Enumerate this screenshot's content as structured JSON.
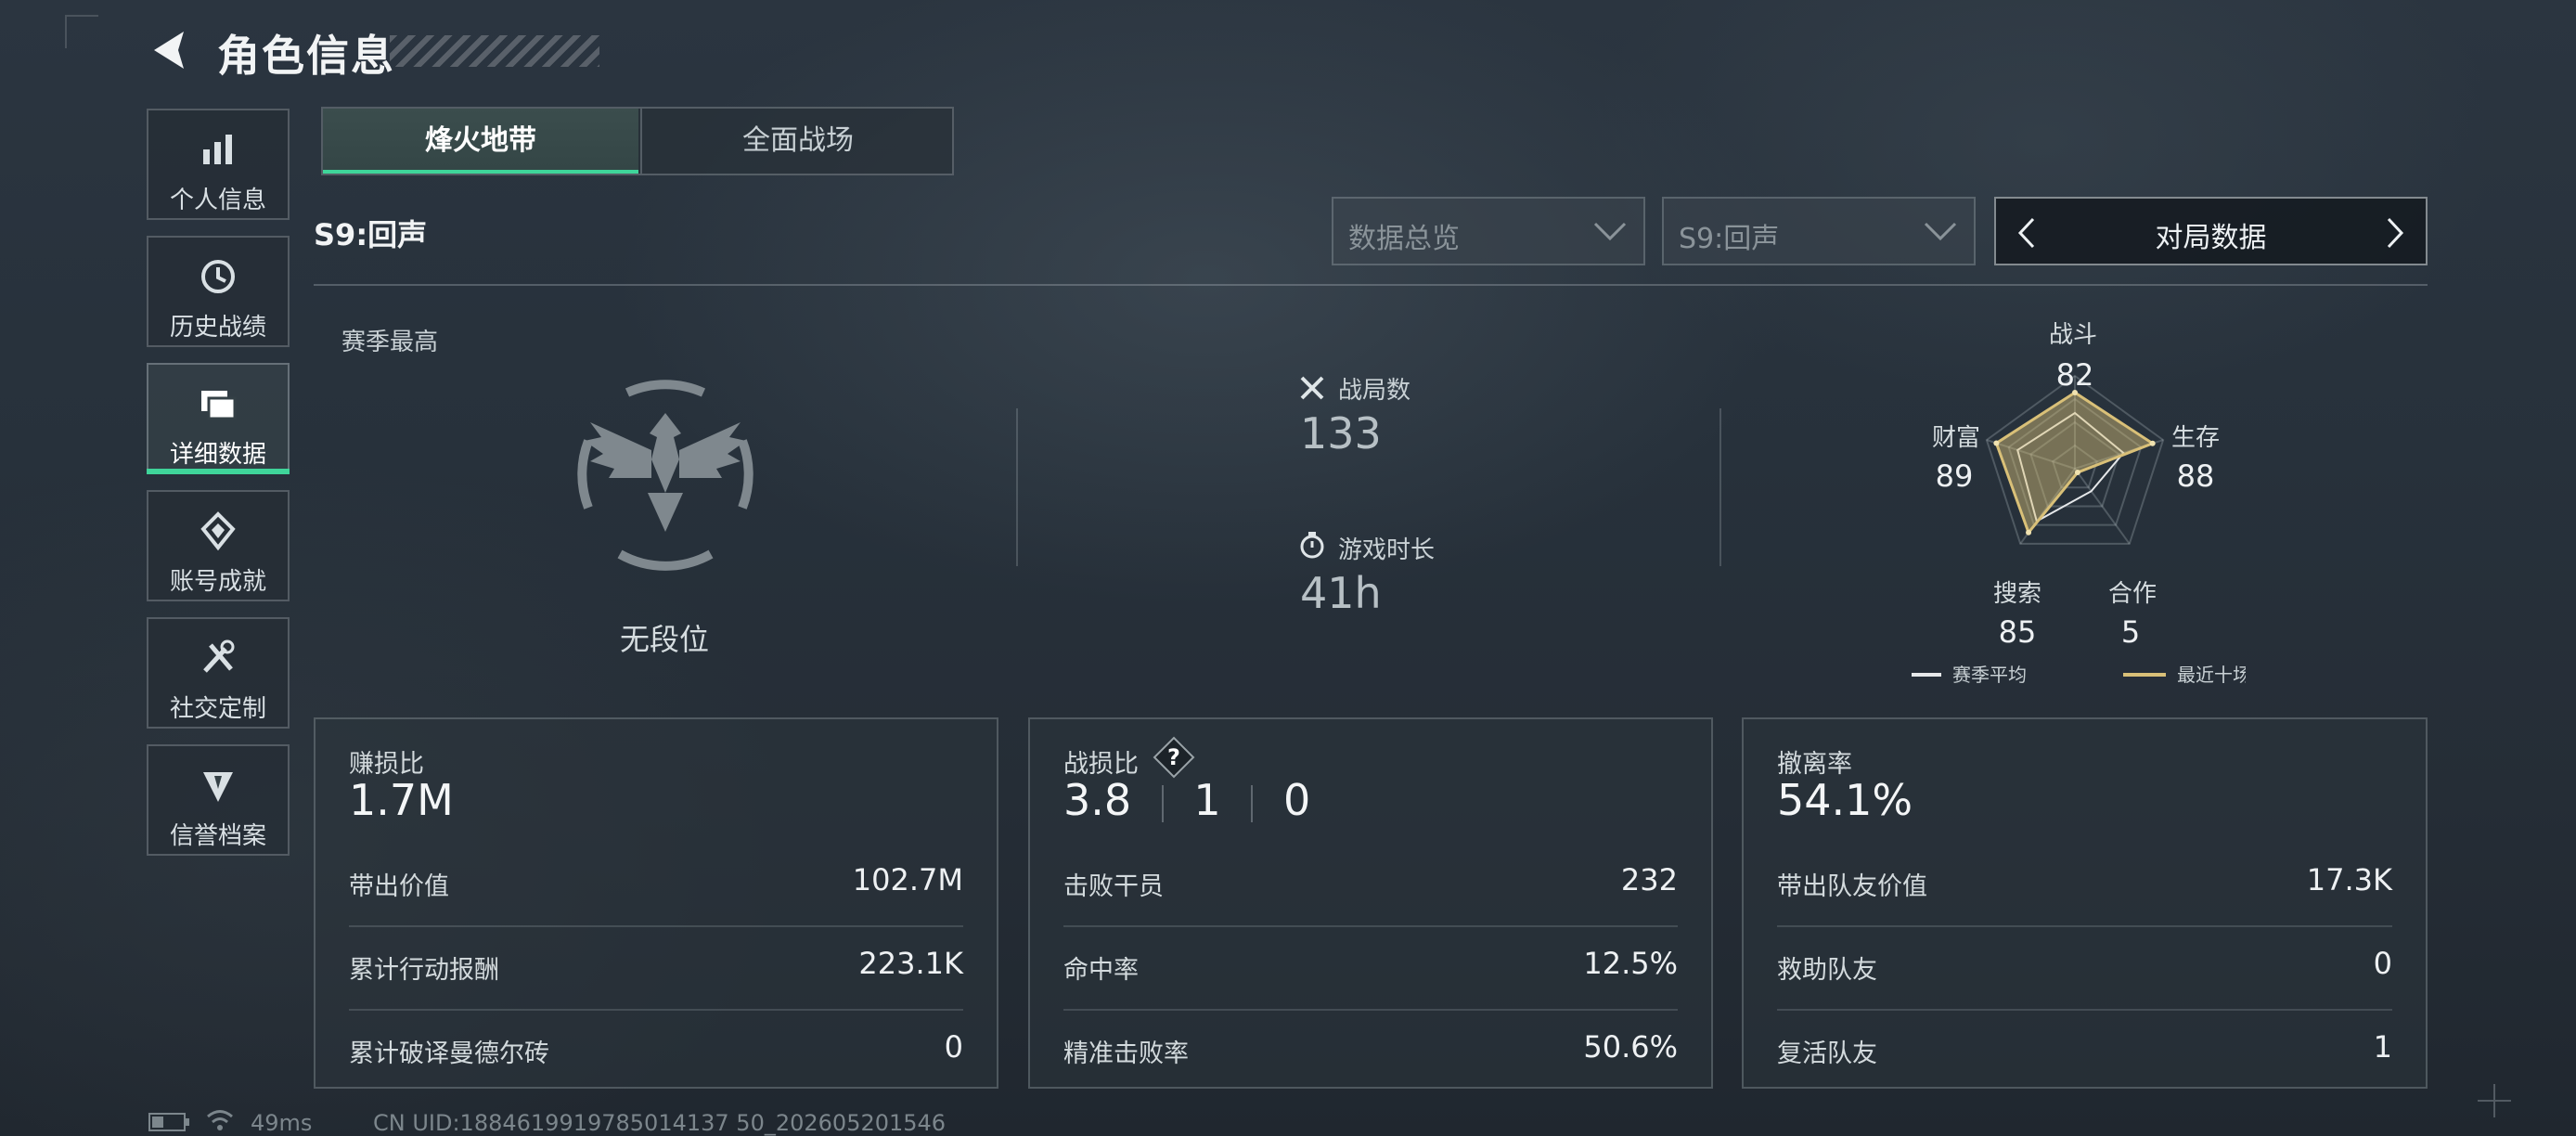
{
  "header": {
    "title": "角色信息"
  },
  "sidebar": {
    "items": [
      {
        "label": "个人信息",
        "icon": "bar-chart-icon"
      },
      {
        "label": "历史战绩",
        "icon": "history-icon"
      },
      {
        "label": "详细数据",
        "icon": "folder-icon",
        "active": true
      },
      {
        "label": "账号成就",
        "icon": "medal-icon"
      },
      {
        "label": "社交定制",
        "icon": "tools-icon"
      },
      {
        "label": "信誉档案",
        "icon": "shield-icon"
      }
    ]
  },
  "tabs": [
    {
      "label": "烽火地带",
      "active": true
    },
    {
      "label": "全面战场"
    }
  ],
  "season_label": "S9:回声",
  "filters": {
    "overview": "数据总览",
    "season": "S9:回声",
    "mode": "对局数据"
  },
  "rank": {
    "title": "赛季最高",
    "value": "无段位"
  },
  "stats": {
    "matches": {
      "label": "战局数",
      "value": "133"
    },
    "playtime": {
      "label": "游戏时长",
      "value": "41h"
    }
  },
  "radar": {
    "axes": [
      {
        "label": "战斗",
        "value": "82"
      },
      {
        "label": "生存",
        "value": "88"
      },
      {
        "label": "合作",
        "value": "5"
      },
      {
        "label": "搜索",
        "value": "85"
      },
      {
        "label": "财富",
        "value": "89"
      }
    ],
    "recent_values": [
      82,
      88,
      5,
      85,
      89
    ],
    "season_avg_values": [
      60,
      55,
      30,
      70,
      65
    ],
    "legend": {
      "season_avg": "赛季平均",
      "recent": "最近十场"
    },
    "colors": {
      "recent": "#d9c078",
      "season_avg": "#e6e8ea"
    }
  },
  "cards": [
    {
      "title": "赚损比",
      "value": "1.7M",
      "rows": [
        {
          "k": "带出价值",
          "v": "102.7M"
        },
        {
          "k": "累计行动报酬",
          "v": "223.1K"
        },
        {
          "k": "累计破译曼德尔砖",
          "v": "0"
        }
      ]
    },
    {
      "title": "战损比",
      "kd": [
        "3.8",
        "1",
        "0"
      ],
      "rows": [
        {
          "k": "击败干员",
          "v": "232"
        },
        {
          "k": "命中率",
          "v": "12.5%"
        },
        {
          "k": "精准击败率",
          "v": "50.6%"
        }
      ]
    },
    {
      "title": "撤离率",
      "value": "54.1%",
      "rows": [
        {
          "k": "带出队友价值",
          "v": "17.3K"
        },
        {
          "k": "救助队友",
          "v": "0"
        },
        {
          "k": "复活队友",
          "v": "1"
        }
      ]
    }
  ],
  "footer": {
    "ping": "49ms",
    "uid": "CN UID:1884619919785014137 50_202605201546"
  },
  "colors": {
    "accent": "#3fd59a"
  }
}
